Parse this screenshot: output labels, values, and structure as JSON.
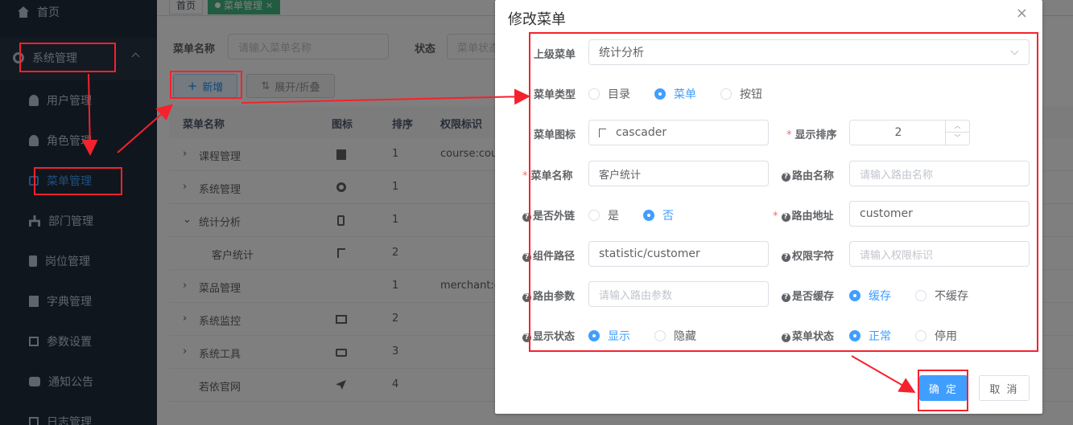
{
  "sidebar": {
    "items": [
      {
        "label": "首页",
        "icon": "home-icon"
      },
      {
        "label": "系统管理",
        "icon": "gear-icon"
      },
      {
        "label": "用户管理",
        "icon": "user-icon"
      },
      {
        "label": "角色管理",
        "icon": "role-icon"
      },
      {
        "label": "菜单管理",
        "icon": "tree-table-icon"
      },
      {
        "label": "部门管理",
        "icon": "tree-icon"
      },
      {
        "label": "岗位管理",
        "icon": "post-icon"
      },
      {
        "label": "字典管理",
        "icon": "dict-icon"
      },
      {
        "label": "参数设置",
        "icon": "edit-icon"
      },
      {
        "label": "通知公告",
        "icon": "message-icon"
      },
      {
        "label": "日志管理",
        "icon": "log-icon"
      }
    ]
  },
  "tabs": [
    {
      "label": "首页"
    },
    {
      "label": "菜单管理"
    }
  ],
  "search": {
    "menu_name_label": "菜单名称",
    "menu_name_placeholder": "请输入菜单名称",
    "status_label": "状态",
    "status_placeholder": "菜单状态"
  },
  "toolbar": {
    "add_label": "新增",
    "expand_label": "展开/折叠"
  },
  "table": {
    "headers": [
      "菜单名称",
      "图标",
      "排序",
      "权限标识"
    ],
    "rows": [
      {
        "name": "课程管理",
        "sort": "1",
        "perm": "course:cou",
        "icon": "documentation-icon"
      },
      {
        "name": "系统管理",
        "sort": "1",
        "perm": "",
        "icon": "gear-icon"
      },
      {
        "name": "统计分析",
        "sort": "1",
        "perm": "",
        "icon": "phone-icon"
      },
      {
        "name": "客户统计",
        "sort": "2",
        "perm": "",
        "icon": "cascader-icon"
      },
      {
        "name": "菜品管理",
        "sort": "1",
        "perm": "merchant:c",
        "icon": ""
      },
      {
        "name": "系统监控",
        "sort": "2",
        "perm": "",
        "icon": "monitor-icon"
      },
      {
        "name": "系统工具",
        "sort": "3",
        "perm": "",
        "icon": "tool-icon"
      },
      {
        "name": "若依官网",
        "sort": "4",
        "perm": "",
        "icon": "guide-icon"
      }
    ]
  },
  "dialog": {
    "title": "修改菜单",
    "parent_label": "上级菜单",
    "parent_value": "统计分析",
    "type_label": "菜单类型",
    "type_options": [
      "目录",
      "菜单",
      "按钮"
    ],
    "type_selected": "菜单",
    "icon_label": "菜单图标",
    "icon_value": "cascader",
    "sort_label": "显示排序",
    "sort_value": "2",
    "name_label": "菜单名称",
    "name_value": "客户统计",
    "route_name_label": "路由名称",
    "route_name_placeholder": "请输入路由名称",
    "external_label": "是否外链",
    "external_options": [
      "是",
      "否"
    ],
    "external_selected": "否",
    "path_label": "路由地址",
    "path_value": "customer",
    "component_label": "组件路径",
    "component_value": "statistic/customer",
    "perms_label": "权限字符",
    "perms_placeholder": "请输入权限标识",
    "query_label": "路由参数",
    "query_placeholder": "请输入路由参数",
    "cache_label": "是否缓存",
    "cache_options": [
      "缓存",
      "不缓存"
    ],
    "cache_selected": "缓存",
    "visible_label": "显示状态",
    "visible_options": [
      "显示",
      "隐藏"
    ],
    "visible_selected": "显示",
    "status_label": "菜单状态",
    "status_options": [
      "正常",
      "停用"
    ],
    "status_selected": "正常",
    "ok_label": "确 定",
    "cancel_label": "取 消"
  },
  "colors": {
    "sidebar_bg": "#1f2d3d",
    "primary": "#409eff",
    "annotation_red": "#f5222d",
    "tag_green": "#42b983"
  }
}
